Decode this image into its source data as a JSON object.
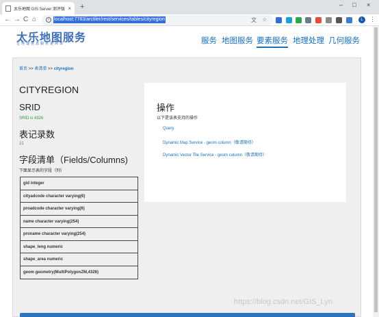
{
  "browser": {
    "tab_title": "太乐地图 GIS Server 测评版",
    "tab_close": "×",
    "new_tab": "+",
    "window_controls": [
      "–",
      "□",
      "×"
    ],
    "nav": {
      "back": "←",
      "forward": "→",
      "reload": "C",
      "home": "⌂"
    },
    "url": "localhost:7783/arctiler/rest/services/tables/cityregion",
    "profile_initial": "L",
    "menu": "⋮"
  },
  "header": {
    "logo": "太乐地图服务",
    "logo_sub": "让地理信息服务更简单",
    "nav": [
      "服务",
      "地图服务",
      "要素服务",
      "地理处理",
      "几何服务"
    ],
    "active_index": 2
  },
  "breadcrumb": {
    "home": "首页",
    "sep1": " >> ",
    "list": "表清单",
    "sep2": " >> ",
    "current": "cityregion"
  },
  "table": {
    "name": "CITYREGION",
    "srid_title": "SRID",
    "srid_text": "SRID is 4326",
    "count_title": "表记录数",
    "count_value": "21",
    "fields_title": "字段清单（Fields/Columns)",
    "fields_note": "下面显示表的字段（列）",
    "fields": [
      "gid integer",
      "cityadcode character varying(6)",
      "proadcode character varying(6)",
      "name character varying(254)",
      "proname character varying(254)",
      "shape_leng numeric",
      "shape_area numeric",
      "geom geometry(MultiPolygonZM,4326)"
    ]
  },
  "operations": {
    "title": "操作",
    "desc": "以下是该表支持的操作",
    "items": [
      {
        "label": "Query",
        "note": ""
      },
      {
        "label": "Dynamic Map Service - geom column",
        "note": "（敬请期待）"
      },
      {
        "label": "Dynamic Vector Tile Service - geom column",
        "note": "（敬请期待）"
      }
    ]
  },
  "watermark": "https://blog.csdn.net/GIS_Lyn",
  "colors": {
    "link": "#1a6fb8",
    "accent": "#3b6fb6",
    "green": "#2e9a2e",
    "bar": "#2e73c2"
  }
}
